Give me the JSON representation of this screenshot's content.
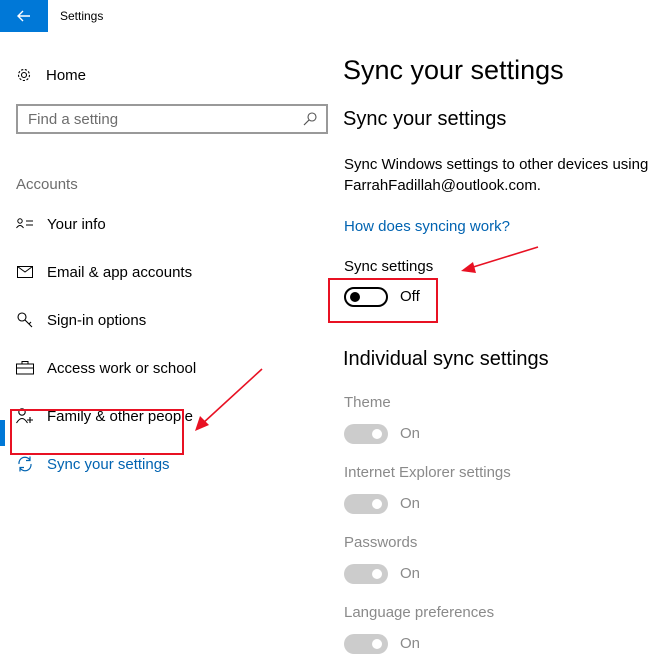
{
  "window": {
    "title": "Settings",
    "back_icon": "back-arrow-icon"
  },
  "sidebar": {
    "home_label": "Home",
    "search_placeholder": "Find a setting",
    "section_label": "Accounts",
    "items": [
      {
        "label": "Your info",
        "icon": "person-card-icon"
      },
      {
        "label": "Email & app accounts",
        "icon": "mail-icon"
      },
      {
        "label": "Sign-in options",
        "icon": "key-icon"
      },
      {
        "label": "Access work or school",
        "icon": "briefcase-icon"
      },
      {
        "label": "Family & other people",
        "icon": "person-add-icon"
      },
      {
        "label": "Sync your settings",
        "icon": "sync-icon",
        "active": true
      }
    ]
  },
  "main": {
    "page_title": "Sync your settings",
    "sub_title": "Sync your settings",
    "description": "Sync Windows settings to other devices using FarrahFadillah@outlook.com.",
    "link": "How does syncing work?",
    "sync_label": "Sync settings",
    "sync_state": "Off",
    "individual_title": "Individual sync settings",
    "individual": [
      {
        "label": "Theme",
        "state": "On"
      },
      {
        "label": "Internet Explorer settings",
        "state": "On"
      },
      {
        "label": "Passwords",
        "state": "On"
      },
      {
        "label": "Language preferences",
        "state": "On"
      }
    ]
  },
  "colors": {
    "accent": "#0078d7",
    "link": "#0063b1",
    "annotation": "#e81123",
    "disabled": "#8a8a8a"
  }
}
